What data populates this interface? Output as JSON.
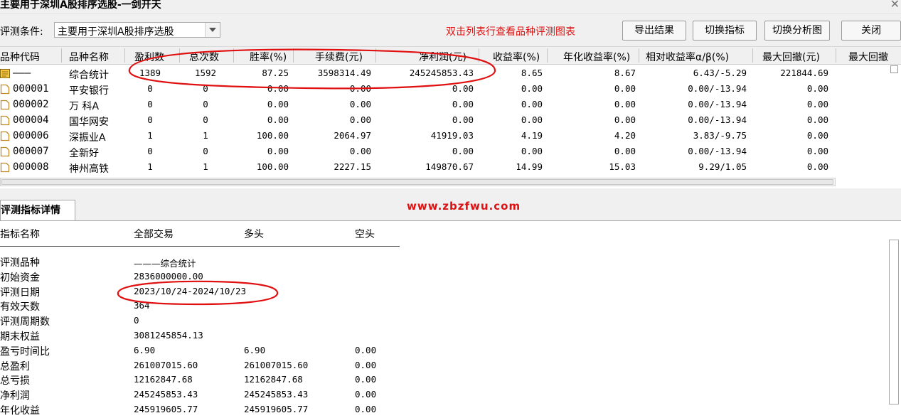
{
  "window": {
    "title": "主要用于深圳A股排序选股-一剑开天",
    "close_glyph": "✕"
  },
  "toolbar": {
    "condition_label": "评测条件:",
    "condition_value": "主要用于深圳A股排序选股",
    "hint": "双击列表行查看品种评测图表",
    "export_label": "导出结果",
    "switch_indicator_label": "切换指标",
    "switch_chart_label": "切换分析图",
    "close_label": "关闭"
  },
  "grid": {
    "columns": [
      "品种代码",
      "品种名称",
      "盈利数",
      "总次数",
      "胜率(%)",
      "手续费(元)",
      "净利润(元)",
      "收益率(%)",
      "年化收益率(%)",
      "相对收益率α/β(%)",
      "最大回撤(元)",
      "最大回撤"
    ],
    "rows": [
      {
        "code": "———",
        "name": "综合统计",
        "wins": "1389",
        "total": "1592",
        "winrate": "87.25",
        "fee": "3598314.49",
        "profit": "245245853.43",
        "ret": "8.65",
        "annual": "8.67",
        "rel": "6.43/-5.29",
        "mdd": "221844.69"
      },
      {
        "code": "000001",
        "name": "平安银行",
        "wins": "0",
        "total": "0",
        "winrate": "0.00",
        "fee": "0.00",
        "profit": "0.00",
        "ret": "0.00",
        "annual": "0.00",
        "rel": "0.00/-13.94",
        "mdd": "0.00"
      },
      {
        "code": "000002",
        "name": "万 科A",
        "wins": "0",
        "total": "0",
        "winrate": "0.00",
        "fee": "0.00",
        "profit": "0.00",
        "ret": "0.00",
        "annual": "0.00",
        "rel": "0.00/-13.94",
        "mdd": "0.00"
      },
      {
        "code": "000004",
        "name": "国华网安",
        "wins": "0",
        "total": "0",
        "winrate": "0.00",
        "fee": "0.00",
        "profit": "0.00",
        "ret": "0.00",
        "annual": "0.00",
        "rel": "0.00/-13.94",
        "mdd": "0.00"
      },
      {
        "code": "000006",
        "name": "深振业A",
        "wins": "1",
        "total": "1",
        "winrate": "100.00",
        "fee": "2064.97",
        "profit": "41919.03",
        "ret": "4.19",
        "annual": "4.20",
        "rel": "3.83/-9.75",
        "mdd": "0.00"
      },
      {
        "code": "000007",
        "name": "全新好",
        "wins": "0",
        "total": "0",
        "winrate": "0.00",
        "fee": "0.00",
        "profit": "0.00",
        "ret": "0.00",
        "annual": "0.00",
        "rel": "0.00/-13.94",
        "mdd": "0.00"
      },
      {
        "code": "000008",
        "name": "神州高铁",
        "wins": "1",
        "total": "1",
        "winrate": "100.00",
        "fee": "2227.15",
        "profit": "149870.67",
        "ret": "14.99",
        "annual": "15.03",
        "rel": "9.29/1.05",
        "mdd": "0.00"
      }
    ]
  },
  "detail_tab": {
    "label": "评测指标详情"
  },
  "watermark": "www.zbzfwu.com",
  "detail": {
    "headers": [
      "指标名称",
      "全部交易",
      "多头",
      "空头"
    ],
    "rows": [
      {
        "label": "评测品种",
        "all": "———综合统计",
        "long": "",
        "short": ""
      },
      {
        "label": "初始资金",
        "all": "2836000000.00",
        "long": "",
        "short": ""
      },
      {
        "label": "评测日期",
        "all": "2023/10/24-2024/10/23",
        "long": "",
        "short": ""
      },
      {
        "label": "有效天数",
        "all": "364",
        "long": "",
        "short": ""
      },
      {
        "label": "评测周期数",
        "all": "0",
        "long": "",
        "short": ""
      },
      {
        "label": "期末权益",
        "all": "3081245854.13",
        "long": "",
        "short": ""
      },
      {
        "label": "盈亏时间比",
        "all": "6.90",
        "long": "6.90",
        "short": "0.00"
      },
      {
        "label": "总盈利",
        "all": "261007015.60",
        "long": "261007015.60",
        "short": "0.00"
      },
      {
        "label": "总亏损",
        "all": "12162847.68",
        "long": "12162847.68",
        "short": "0.00"
      },
      {
        "label": "净利润",
        "all": "245245853.43",
        "long": "245245853.43",
        "short": "0.00"
      },
      {
        "label": "年化收益",
        "all": "245919605.77",
        "long": "245919605.77",
        "short": "0.00"
      }
    ]
  },
  "colors": {
    "annotation": "#e01010",
    "hint": "#e01010",
    "chrome": "#f0f0f0"
  }
}
